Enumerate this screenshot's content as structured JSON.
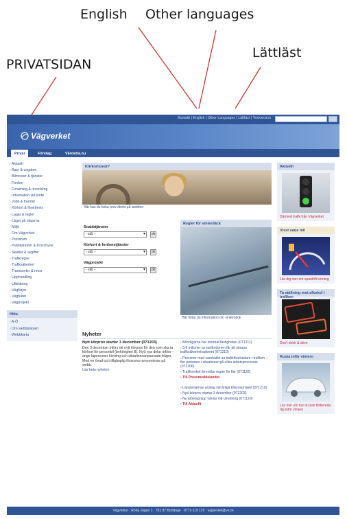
{
  "callouts": {
    "english": "English",
    "other_languages": "Other languages",
    "lattlast": "Lättläst",
    "privatsidan": "PRIVATSIDAN"
  },
  "topbar": {
    "links": "Kontakt | English | Other Languages | Lättläst | Textversion",
    "search_placeholder": "",
    "go_label": "Sök"
  },
  "header": {
    "logo_text": "Vägverket"
  },
  "tabs": [
    "Privat",
    "Företag",
    "Vårdetta.nu"
  ],
  "left_nav": [
    "Aktuellt",
    "Barn & ungdom",
    "Bilmoster & tjänster",
    "Fordon",
    "Forskning & utveckling",
    "Information vid körte",
    "Jobb & framtid",
    "Körkort & förarbevis",
    "Lagar & regler",
    "Läget på vägarna",
    "Miljö",
    "Om Vägverket",
    "Pressrum",
    "Publikationer & broschyrer",
    "Skatter & avgifter",
    "Trafikregler",
    "Trafiksäkerhet",
    "Transporter & resor",
    "Upphandling",
    "Utbildning",
    "Vägfärjor",
    "Vägnätet",
    "Vägprojekt"
  ],
  "left_box": {
    "title": "Hitta",
    "items": [
      "A-Ö",
      "Om webbplatsen",
      "Webbkarta"
    ]
  },
  "center": {
    "band1": "Körkortstest?",
    "band1_caption": "Här kan du boka prov direkt på webben",
    "form": {
      "label1": "Snabbtjänster",
      "label2": "Körkort & fordonstjänster",
      "label3": "Vägprojekt",
      "select_value": "- välj -",
      "ok_label": "ok"
    },
    "winter": {
      "title": "Regler för vinterdäck",
      "caption": "Här hittar du information om vinterdäck"
    },
    "news": {
      "heading": "Nyheter",
      "title": "Nytt körprov startar 3 december (071203)",
      "body": "Den 3 december införs ett nytt körprov för den som ska ta körkort för personbil (behörighet B). Nytt nya delar införs – ange lapersoner körning och situationsanpassade frågor. Med en övad och tillgänglig förarprov presenteras på webb.",
      "more": "Läs hela nyheten",
      "links": [
        "Börvägarna har stormat fastigheten (071211)",
        "3,6 miljoner av taxifordonen får att stoppa trafiksäkerhetsarbetet (071210)",
        "Personer med samhället av trafikföreträdare i trafiken – fler personer i situationer på olika arbetsprocesser (071206)",
        "Trafikverket förenklar regler för fler (071128)",
        "Till Pressmeddelandet",
        "Länsbroarnas anslag vid årliga tillsynsprojekt (071210)",
        "Nytt körprov startar 3 december (071203)",
        "Ny arbetsgrupp väntar vid utredning (071129)",
        "Till Aktuellt"
      ]
    }
  },
  "right": {
    "box1": {
      "title": "Aktuellt",
      "caption": "Därmed trafik från Vägverket"
    },
    "box2": {
      "title": "Visst varje mil",
      "caption": "Läs dig mer om spardrift körning"
    },
    "box3": {
      "title": "Ta ställning mot alkohol i trafiken",
      "caption": "Don't drink & drive"
    },
    "box4": {
      "title": "Rusta inför vintern",
      "caption": "Läs mer om hur du kan förbereda dig inför vintern"
    }
  },
  "footer": {
    "text": "Vägverket · Röda vägen 1 · 781 87 Borlänge · 0771-119 119 · vagverket@vv.se"
  },
  "colors": {
    "brand_blue": "#2f5597",
    "link_blue": "#2f4f8a",
    "accent_red": "#c0283a"
  }
}
